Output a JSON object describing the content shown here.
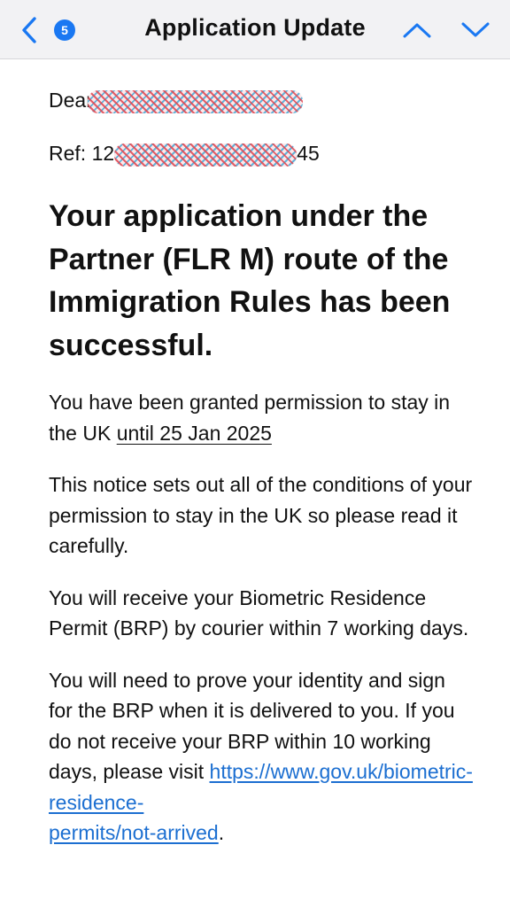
{
  "navbar": {
    "title": "Application Update",
    "unread_count": "5",
    "accent_color": "#1a78f2",
    "back_icon": "chevron-left-icon",
    "up_icon": "chevron-up-icon",
    "down_icon": "chevron-down-icon"
  },
  "email": {
    "greeting_prefix": "Dear",
    "ref_prefix": "Ref: 12",
    "ref_suffix": "45",
    "heading": "Your application under the Partner (FLR M) route of the Immigration Rules has been successful.",
    "para1_text": "You have been granted permission to stay in the UK ",
    "para1_link": "until 25 Jan 2025",
    "para2": "This notice sets out all of the conditions of your permission to stay in the UK so please read it carefully.",
    "para3": "You will receive your Biometric Residence Permit (BRP) by courier within 7 working days.",
    "para4_text": "You will need to prove your identity and sign for the BRP when it is delivered to you. If you do not receive your BRP within 10 working days, please visit ",
    "para4_url_line1": "https://www.gov.uk/biometric-residence-",
    "para4_url_line2": "permits/not-arrived",
    "para4_end": "."
  }
}
